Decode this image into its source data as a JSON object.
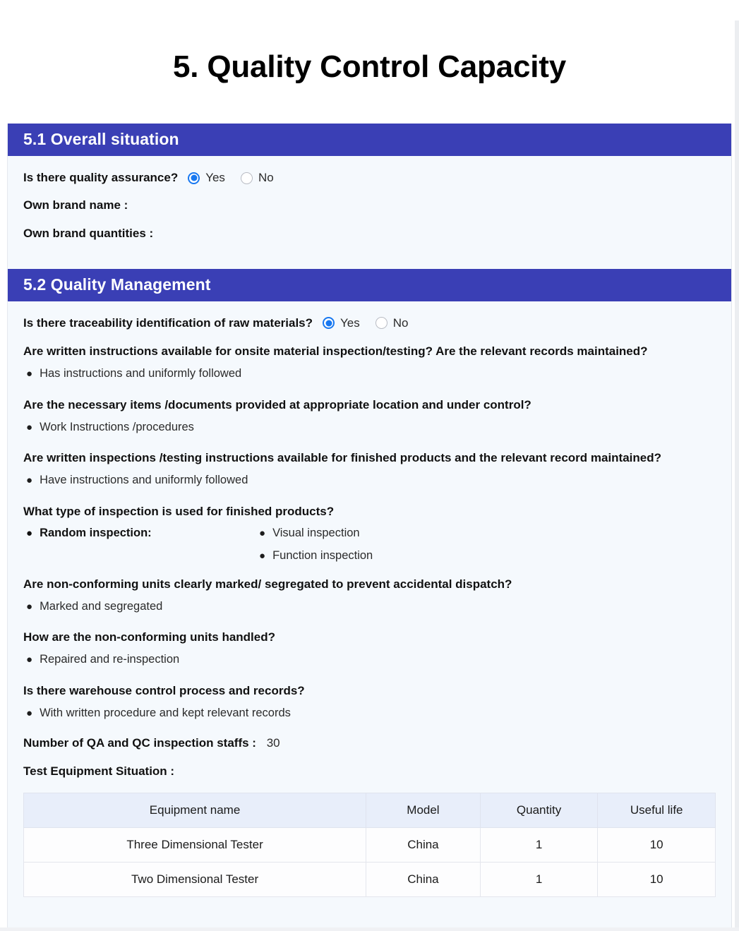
{
  "document": {
    "title": "5. Quality Control Capacity"
  },
  "sections": [
    {
      "id": "overall-situation",
      "heading": "5.1 Overall situation",
      "question_label": "Is there quality assurance?",
      "radio_options": [
        {
          "label": "Yes",
          "selected": true
        },
        {
          "label": "No",
          "selected": false
        }
      ],
      "fields": [
        {
          "label": "Own brand name :",
          "value": ""
        },
        {
          "label": "Own brand quantities :",
          "value": ""
        }
      ]
    },
    {
      "id": "quality-management",
      "heading": "5.2 Quality Management",
      "traceability": {
        "question": "Is there traceability identification of raw materials?",
        "radio_options": [
          {
            "label": "Yes",
            "selected": true
          },
          {
            "label": "No",
            "selected": false
          }
        ]
      },
      "qa_items": [
        {
          "question": "Are written instructions available for onsite material inspection/testing? Are the relevant records maintained?",
          "answer": "Has instructions and uniformly followed"
        },
        {
          "question": "Are the necessary items /documents provided at appropriate location and under control?",
          "answer": "Work Instructions /procedures"
        },
        {
          "question": "Are written inspections /testing instructions available for finished products and the relevant record maintained?",
          "answer": "Have instructions and uniformly followed"
        }
      ],
      "inspection_type": {
        "question": "What type of inspection is used for finished products?",
        "primary": "Random inspection:",
        "details": [
          "Visual inspection",
          "Function inspection"
        ]
      },
      "qa_items_2": [
        {
          "question": "Are non-conforming units clearly marked/ segregated to prevent accidental dispatch?",
          "answer": "Marked and segregated"
        },
        {
          "question": "How are the non-conforming units handled?",
          "answer": "Repaired and re-inspection"
        },
        {
          "question": "Is there warehouse control process and records?",
          "answer": "With written procedure and kept relevant records"
        }
      ],
      "staff_count": {
        "label": "Number of QA and QC inspection staffs :",
        "value": "30"
      },
      "equipment": {
        "label": "Test Equipment Situation :",
        "columns": [
          "Equipment name",
          "Model",
          "Quantity",
          "Useful life"
        ],
        "rows": [
          [
            "Three Dimensional Tester",
            "China",
            "1",
            "10"
          ],
          [
            "Two Dimensional Tester",
            "China",
            "1",
            "10"
          ]
        ]
      }
    }
  ],
  "theme": {
    "section_bar_color": "#3a3fb5",
    "radio_accent": "#1878f0",
    "page_background": "#f5f9fd",
    "table_header_background": "#e8eefa"
  }
}
